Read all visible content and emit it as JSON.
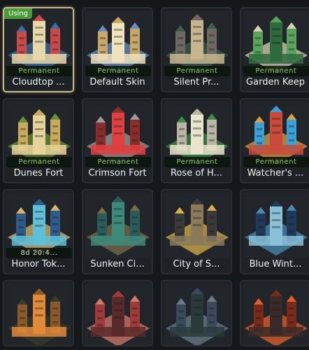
{
  "skins": [
    {
      "name": "Cloudtop ...",
      "tag": "Permanent",
      "using": "Using",
      "palette": [
        "#c94a4a",
        "#3c6ea0",
        "#e8d7a8"
      ]
    },
    {
      "name": "Default Skin",
      "tag": "Permanent",
      "palette": [
        "#c8a86a",
        "#6b8dbf",
        "#efe2bd"
      ]
    },
    {
      "name": "Silent Pr...",
      "tag": "Permanent",
      "palette": [
        "#6e6a62",
        "#3f5c4d",
        "#c7b58f"
      ]
    },
    {
      "name": "Garden Keep",
      "tag": "Permanent",
      "palette": [
        "#5aa35d",
        "#d8d0b5",
        "#2f6a3c"
      ]
    },
    {
      "name": "Dunes Fort",
      "tag": "Permanent",
      "palette": [
        "#c9a95c",
        "#6a8e3a",
        "#e6d39a"
      ]
    },
    {
      "name": "Crimson Fort",
      "tag": "Permanent",
      "palette": [
        "#8a2c2c",
        "#9a9a9a",
        "#e04040"
      ]
    },
    {
      "name": "Rose of H...",
      "tag": "Permanent",
      "palette": [
        "#b9b6a6",
        "#3f8a4a",
        "#e9e4cc"
      ]
    },
    {
      "name": "Watcher's ...",
      "tag": "Permanent",
      "palette": [
        "#3aa0d6",
        "#d6a04a",
        "#c94a3a"
      ]
    },
    {
      "name": "Honor Tok...",
      "tag": "8d 20:4...",
      "palette": [
        "#2e5b8a",
        "#d6b46a",
        "#5ec0d8"
      ]
    },
    {
      "name": "Sunken Ci...",
      "tag": "",
      "palette": [
        "#2a5a5a",
        "#7a6a4a",
        "#3e8a7a"
      ]
    },
    {
      "name": "City of S...",
      "tag": "",
      "palette": [
        "#3a3a3a",
        "#d6b04a",
        "#8a7a5a"
      ]
    },
    {
      "name": "Blue Wint...",
      "tag": "",
      "palette": [
        "#1f3a5a",
        "#4a8ab0",
        "#8ac0d8"
      ]
    },
    {
      "name": "",
      "tag": "",
      "palette": [
        "#8a5a2a",
        "#3a3a2a",
        "#e08a3a"
      ]
    },
    {
      "name": "",
      "tag": "",
      "palette": [
        "#a03a3a",
        "#d07a6a",
        "#5a2a2a"
      ]
    },
    {
      "name": "",
      "tag": "",
      "palette": [
        "#3a4a5a",
        "#6a7a8a",
        "#2a3a3a"
      ]
    },
    {
      "name": "",
      "tag": "",
      "palette": [
        "#7a2a1a",
        "#e0602a",
        "#3a2a2a"
      ]
    }
  ]
}
